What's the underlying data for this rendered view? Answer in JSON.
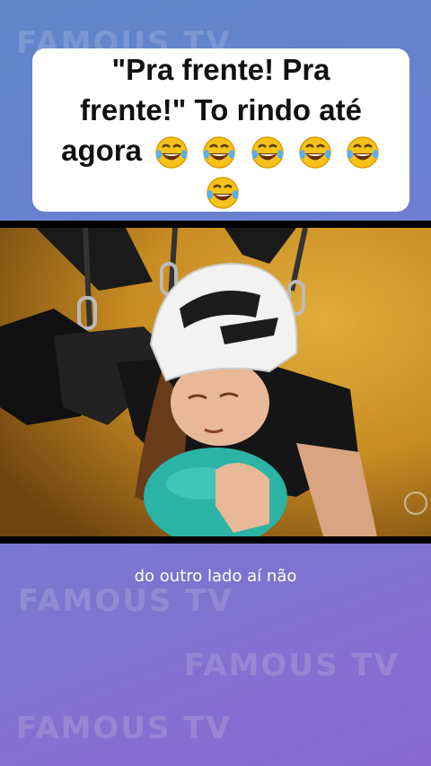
{
  "watermark": {
    "text": "FAMOUS TV"
  },
  "caption": {
    "line1": "\"Pra frente! Pra",
    "line2": "frente!\" To rindo até",
    "line3": "agora",
    "emojis": [
      "rolling-on-floor-laughing",
      "rolling-on-floor-laughing",
      "rolling-on-floor-laughing",
      "rolling-on-floor-laughing",
      "rolling-on-floor-laughing",
      "rolling-on-floor-laughing"
    ]
  },
  "video": {
    "subtitle": "do outro lado aí não"
  },
  "colors": {
    "background_top": "#5f86c9",
    "background_bottom": "#8a6ad0",
    "caption_bg": "#ffffff",
    "video_bg": "#000000",
    "helmet": "#f2f2f2",
    "sky": "#c98d22",
    "ball": "#2bb3a6"
  }
}
